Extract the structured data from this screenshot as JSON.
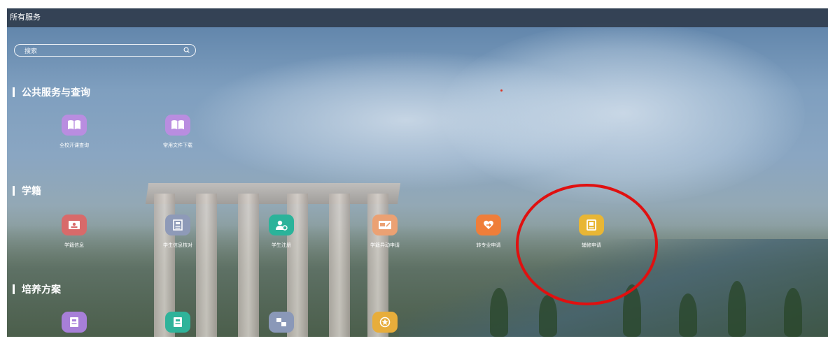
{
  "header": {
    "title": "所有服务"
  },
  "search": {
    "placeholder": "搜索",
    "icon": "search-icon"
  },
  "sections": [
    {
      "title": "公共服务与查询",
      "items": [
        {
          "label": "全校开课查询",
          "icon": "book-icon",
          "color": "#b98de0"
        },
        {
          "label": "常用文件下载",
          "icon": "book-icon",
          "color": "#b98de0"
        }
      ]
    },
    {
      "title": "学籍",
      "items": [
        {
          "label": "学籍信息",
          "icon": "id-card-icon",
          "color": "#d86a6a"
        },
        {
          "label": "学生信息核对",
          "icon": "document-icon",
          "color": "#8e9ab8"
        },
        {
          "label": "学生注册",
          "icon": "user-icon",
          "color": "#2bb39a"
        },
        {
          "label": "学籍异动申请",
          "icon": "card-edit-icon",
          "color": "#eba173"
        },
        {
          "label": "转专业申请",
          "icon": "transfer-icon",
          "color": "#ef7e3a"
        },
        {
          "label": "辅修申请",
          "icon": "minor-book-icon",
          "color": "#e8b635"
        }
      ]
    },
    {
      "title": "培养方案",
      "items": [
        {
          "label": "",
          "icon": "plan-icon",
          "color": "#a77fd8"
        },
        {
          "label": "",
          "icon": "plan-icon",
          "color": "#2fb39a"
        },
        {
          "label": "",
          "icon": "compare-icon",
          "color": "#8a98b8"
        },
        {
          "label": "",
          "icon": "badge-icon",
          "color": "#e7ad3b"
        }
      ]
    }
  ]
}
